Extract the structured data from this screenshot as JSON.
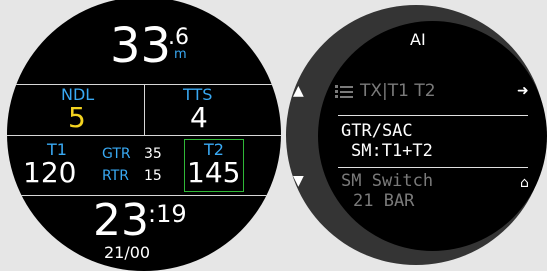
{
  "dive": {
    "depth_main": "33",
    "depth_decimal": ".6",
    "depth_unit": "m",
    "ndl_label": "NDL",
    "ndl_value": "5",
    "tts_label": "TTS",
    "tts_value": "4",
    "t1_label": "T1",
    "t1_value": "120",
    "gtr_label": "GTR",
    "gtr_value": "35",
    "rtr_label": "RTR",
    "rtr_value": "15",
    "t2_label": "T2",
    "t2_value": "145",
    "time_main": "23",
    "time_seconds": ":19",
    "footer": "21/00"
  },
  "ai_menu": {
    "title": "AI",
    "item1_label": "TX|T1 T2",
    "item2_line1": "GTR/SAC",
    "item2_line2": "SM:T1+T2",
    "item3_line1": "SM Switch",
    "item3_line2": "21 BAR"
  },
  "icons": {
    "up": "up-arrow-icon",
    "down": "down-arrow-icon",
    "right": "right-arrow-icon",
    "home": "home-icon",
    "list": "list-icon"
  },
  "colors": {
    "accent_blue": "#39a9f3",
    "ndl_yellow": "#f3d320",
    "highlight_green": "#2fb837"
  }
}
